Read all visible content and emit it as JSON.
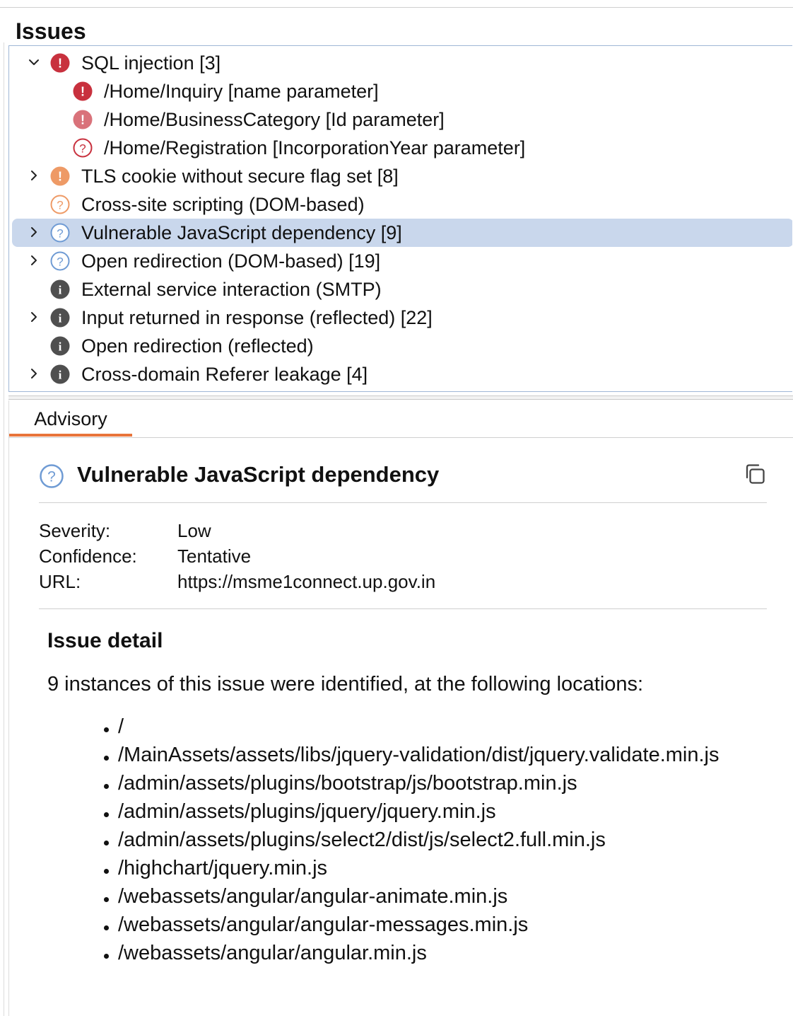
{
  "panel": {
    "title": "Issues"
  },
  "colors": {
    "high": "#c8313e",
    "high_tentative": "#d9727a",
    "medium": "#ee9a66",
    "low": "#6f9bd4",
    "info": "#4f4f4f",
    "selection": "#c9d7ec",
    "tab_underline": "#e8743b"
  },
  "issues": [
    {
      "label": "SQL injection [3]",
      "severity": "high",
      "certainty": "certain",
      "icon": "exclamation-icon",
      "indent": 0,
      "chevron": "down"
    },
    {
      "label": "/Home/Inquiry [name parameter]",
      "severity": "high",
      "certainty": "certain",
      "icon": "exclamation-icon",
      "indent": 1,
      "chevron": "none"
    },
    {
      "label": "/Home/BusinessCategory [Id parameter]",
      "severity": "high",
      "certainty": "firm",
      "icon": "exclamation-icon",
      "indent": 1,
      "chevron": "none"
    },
    {
      "label": "/Home/Registration [IncorporationYear parameter]",
      "severity": "high",
      "certainty": "tentative",
      "icon": "question-icon",
      "indent": 1,
      "chevron": "none"
    },
    {
      "label": "TLS cookie without secure flag set [8]",
      "severity": "medium",
      "certainty": "certain",
      "icon": "exclamation-icon",
      "indent": 0,
      "chevron": "right"
    },
    {
      "label": "Cross-site scripting (DOM-based)",
      "severity": "medium",
      "certainty": "tentative",
      "icon": "question-icon",
      "indent": 0,
      "chevron": "none"
    },
    {
      "label": "Vulnerable JavaScript dependency [9]",
      "severity": "low",
      "certainty": "tentative",
      "icon": "question-icon",
      "indent": 0,
      "chevron": "right",
      "selected": true
    },
    {
      "label": "Open redirection (DOM-based) [19]",
      "severity": "low",
      "certainty": "tentative",
      "icon": "question-icon",
      "indent": 0,
      "chevron": "right"
    },
    {
      "label": "External service interaction (SMTP)",
      "severity": "info",
      "certainty": "certain",
      "icon": "info-icon",
      "indent": 0,
      "chevron": "none"
    },
    {
      "label": "Input returned in response (reflected) [22]",
      "severity": "info",
      "certainty": "certain",
      "icon": "info-icon",
      "indent": 0,
      "chevron": "right"
    },
    {
      "label": "Open redirection (reflected)",
      "severity": "info",
      "certainty": "certain",
      "icon": "info-icon",
      "indent": 0,
      "chevron": "none"
    },
    {
      "label": "Cross-domain Referer leakage [4]",
      "severity": "info",
      "certainty": "certain",
      "icon": "info-icon",
      "indent": 0,
      "chevron": "right"
    }
  ],
  "advisory": {
    "tab_label": "Advisory",
    "title": "Vulnerable JavaScript dependency",
    "title_icon": "question-icon",
    "meta": [
      {
        "key": "Severity:",
        "value": "Low"
      },
      {
        "key": "Confidence:",
        "value": "Tentative"
      },
      {
        "key": "URL:",
        "value": "https://msme1connect.up.gov.in"
      }
    ],
    "detail_heading": "Issue detail",
    "detail_text": "9 instances of this issue were identified, at the following locations:",
    "locations": [
      "/",
      "/MainAssets/assets/libs/jquery-validation/dist/jquery.validate.min.js",
      "/admin/assets/plugins/bootstrap/js/bootstrap.min.js",
      "/admin/assets/plugins/jquery/jquery.min.js",
      "/admin/assets/plugins/select2/dist/js/select2.full.min.js",
      "/highchart/jquery.min.js",
      "/webassets/angular/angular-animate.min.js",
      "/webassets/angular/angular-messages.min.js",
      "/webassets/angular/angular.min.js"
    ]
  }
}
